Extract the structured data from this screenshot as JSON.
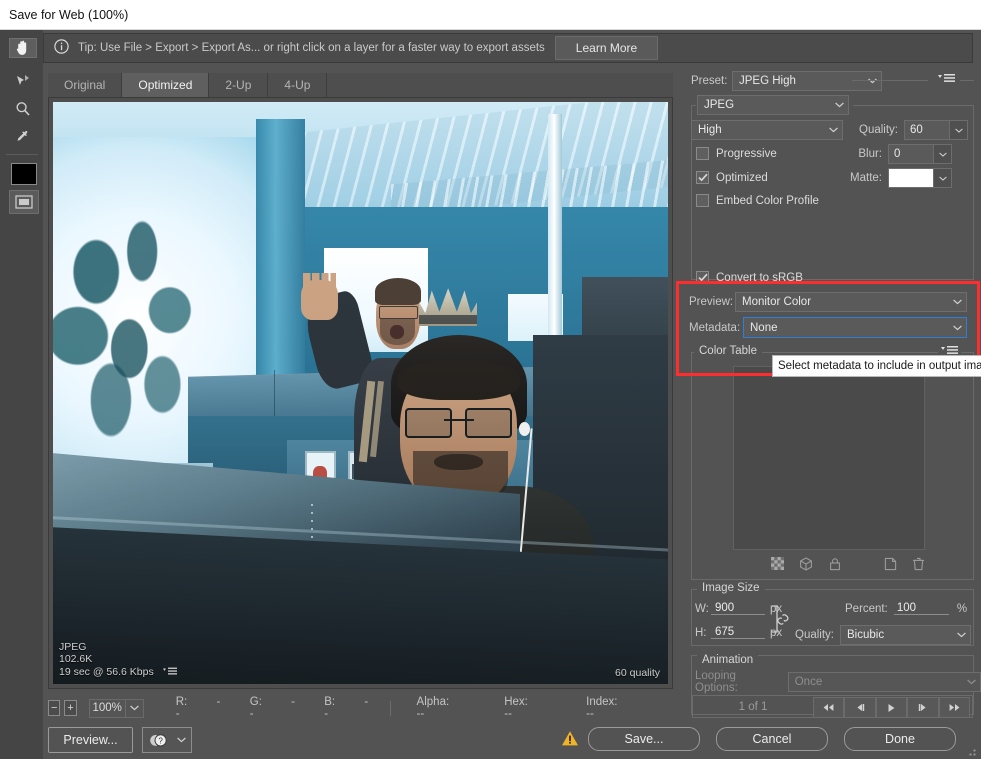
{
  "window": {
    "title": "Save for Web (100%)"
  },
  "tipbar": {
    "icon": "info-icon",
    "text": "Tip: Use File > Export > Export As...  or right click on a layer for a faster way to export assets",
    "learn_more": "Learn More"
  },
  "toolbar": {
    "tools": [
      {
        "name": "hand-tool",
        "icon": "hand-icon",
        "selected": true
      },
      {
        "name": "slice-select-tool",
        "icon": "slice-select-icon",
        "selected": false
      },
      {
        "name": "zoom-tool",
        "icon": "magnifier-icon",
        "selected": false
      },
      {
        "name": "eyedropper-tool",
        "icon": "eyedropper-icon",
        "selected": false
      },
      {
        "name": "foreground-color",
        "icon": "color-swatch-icon",
        "color": "#000000"
      },
      {
        "name": "toggle-slices",
        "icon": "slices-visibility-icon"
      }
    ]
  },
  "tabs": [
    {
      "label": "Original",
      "active": false
    },
    {
      "label": "Optimized",
      "active": true
    },
    {
      "label": "2-Up",
      "active": false
    },
    {
      "label": "4-Up",
      "active": false
    }
  ],
  "preview": {
    "format": "JPEG",
    "filesize": "102.6K",
    "download_time": "19 sec @ 56.6 Kbps",
    "quality_label": "60 quality",
    "menu_icon": "panel-menu-icon"
  },
  "zoom_bar": {
    "zoom_out": "−",
    "zoom_in": "+",
    "level": "100%",
    "color_readout": [
      {
        "label": "R:",
        "value": "--"
      },
      {
        "label": "G:",
        "value": "--"
      },
      {
        "label": "B:",
        "value": "--"
      }
    ],
    "extra_readout": [
      {
        "label": "Alpha:",
        "value": "--"
      },
      {
        "label": "Hex:",
        "value": "--"
      },
      {
        "label": "Index:",
        "value": "--"
      }
    ]
  },
  "settings": {
    "preset_label": "Preset:",
    "preset_value": "JPEG High",
    "panel_menu_icon": "panel-menu-icon",
    "format_value": "JPEG",
    "compression_value": "High",
    "quality_label": "Quality:",
    "quality_value": "60",
    "blur_label": "Blur:",
    "blur_value": "0",
    "matte_label": "Matte:",
    "matte_color": "#ffffff",
    "progressive_label": "Progressive",
    "progressive_checked": false,
    "optimized_label": "Optimized",
    "optimized_checked": true,
    "embed_profile_label": "Embed Color Profile",
    "embed_profile_checked": false,
    "convert_srgb_label": "Convert to sRGB",
    "convert_srgb_checked": true,
    "preview_label": "Preview:",
    "preview_value": "Monitor Color",
    "metadata_label": "Metadata:",
    "metadata_value": "None"
  },
  "tooltip": {
    "text": "Select metadata to include in output images"
  },
  "color_table": {
    "title": "Color Table",
    "panel_menu_icon": "panel-menu-icon",
    "icons": [
      {
        "name": "transparency-icon"
      },
      {
        "name": "web-safe-cube-icon"
      },
      {
        "name": "lock-color-icon"
      },
      {
        "name": "new-color-icon"
      },
      {
        "name": "delete-color-icon"
      }
    ]
  },
  "image_size": {
    "title": "Image Size",
    "w_label": "W:",
    "w_value": "900",
    "w_unit": "px",
    "h_label": "H:",
    "h_value": "675",
    "h_unit": "px",
    "link_icon": "chain-link-icon",
    "percent_label": "Percent:",
    "percent_value": "100",
    "percent_unit": "%",
    "quality_label": "Quality:",
    "quality_value": "Bicubic"
  },
  "animation": {
    "title": "Animation",
    "looping_label": "Looping Options:",
    "looping_value": "Once",
    "frame_counter": "1 of 1",
    "controls": [
      {
        "name": "first-frame-button",
        "glyph": "◀◀"
      },
      {
        "name": "previous-frame-button",
        "glyph": "◀|"
      },
      {
        "name": "play-button",
        "glyph": "▶"
      },
      {
        "name": "next-frame-button",
        "glyph": "|▶"
      },
      {
        "name": "last-frame-button",
        "glyph": "▶▶"
      }
    ]
  },
  "footer": {
    "preview_button": "Preview...",
    "browser_icon": "browser-preview-icon",
    "warning_icon": "warning-icon",
    "save_button": "Save...",
    "cancel_button": "Cancel",
    "done_button": "Done"
  },
  "colors": {
    "highlight": "#ff2d2d",
    "focus_border": "#2f7fd6",
    "panel_bg": "#535353",
    "warning": "#f0b429"
  }
}
